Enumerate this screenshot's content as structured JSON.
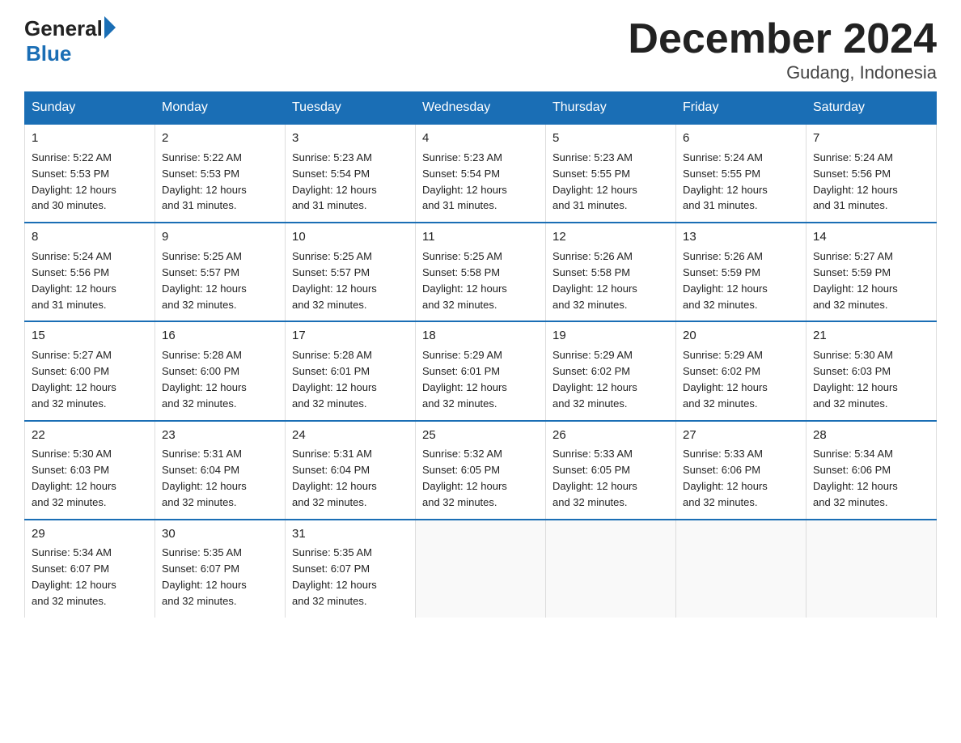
{
  "header": {
    "logo_general": "General",
    "logo_blue": "Blue",
    "month_title": "December 2024",
    "location": "Gudang, Indonesia"
  },
  "days_of_week": [
    "Sunday",
    "Monday",
    "Tuesday",
    "Wednesday",
    "Thursday",
    "Friday",
    "Saturday"
  ],
  "weeks": [
    [
      {
        "day": "1",
        "sunrise": "5:22 AM",
        "sunset": "5:53 PM",
        "daylight": "12 hours and 30 minutes."
      },
      {
        "day": "2",
        "sunrise": "5:22 AM",
        "sunset": "5:53 PM",
        "daylight": "12 hours and 31 minutes."
      },
      {
        "day": "3",
        "sunrise": "5:23 AM",
        "sunset": "5:54 PM",
        "daylight": "12 hours and 31 minutes."
      },
      {
        "day": "4",
        "sunrise": "5:23 AM",
        "sunset": "5:54 PM",
        "daylight": "12 hours and 31 minutes."
      },
      {
        "day": "5",
        "sunrise": "5:23 AM",
        "sunset": "5:55 PM",
        "daylight": "12 hours and 31 minutes."
      },
      {
        "day": "6",
        "sunrise": "5:24 AM",
        "sunset": "5:55 PM",
        "daylight": "12 hours and 31 minutes."
      },
      {
        "day": "7",
        "sunrise": "5:24 AM",
        "sunset": "5:56 PM",
        "daylight": "12 hours and 31 minutes."
      }
    ],
    [
      {
        "day": "8",
        "sunrise": "5:24 AM",
        "sunset": "5:56 PM",
        "daylight": "12 hours and 31 minutes."
      },
      {
        "day": "9",
        "sunrise": "5:25 AM",
        "sunset": "5:57 PM",
        "daylight": "12 hours and 32 minutes."
      },
      {
        "day": "10",
        "sunrise": "5:25 AM",
        "sunset": "5:57 PM",
        "daylight": "12 hours and 32 minutes."
      },
      {
        "day": "11",
        "sunrise": "5:25 AM",
        "sunset": "5:58 PM",
        "daylight": "12 hours and 32 minutes."
      },
      {
        "day": "12",
        "sunrise": "5:26 AM",
        "sunset": "5:58 PM",
        "daylight": "12 hours and 32 minutes."
      },
      {
        "day": "13",
        "sunrise": "5:26 AM",
        "sunset": "5:59 PM",
        "daylight": "12 hours and 32 minutes."
      },
      {
        "day": "14",
        "sunrise": "5:27 AM",
        "sunset": "5:59 PM",
        "daylight": "12 hours and 32 minutes."
      }
    ],
    [
      {
        "day": "15",
        "sunrise": "5:27 AM",
        "sunset": "6:00 PM",
        "daylight": "12 hours and 32 minutes."
      },
      {
        "day": "16",
        "sunrise": "5:28 AM",
        "sunset": "6:00 PM",
        "daylight": "12 hours and 32 minutes."
      },
      {
        "day": "17",
        "sunrise": "5:28 AM",
        "sunset": "6:01 PM",
        "daylight": "12 hours and 32 minutes."
      },
      {
        "day": "18",
        "sunrise": "5:29 AM",
        "sunset": "6:01 PM",
        "daylight": "12 hours and 32 minutes."
      },
      {
        "day": "19",
        "sunrise": "5:29 AM",
        "sunset": "6:02 PM",
        "daylight": "12 hours and 32 minutes."
      },
      {
        "day": "20",
        "sunrise": "5:29 AM",
        "sunset": "6:02 PM",
        "daylight": "12 hours and 32 minutes."
      },
      {
        "day": "21",
        "sunrise": "5:30 AM",
        "sunset": "6:03 PM",
        "daylight": "12 hours and 32 minutes."
      }
    ],
    [
      {
        "day": "22",
        "sunrise": "5:30 AM",
        "sunset": "6:03 PM",
        "daylight": "12 hours and 32 minutes."
      },
      {
        "day": "23",
        "sunrise": "5:31 AM",
        "sunset": "6:04 PM",
        "daylight": "12 hours and 32 minutes."
      },
      {
        "day": "24",
        "sunrise": "5:31 AM",
        "sunset": "6:04 PM",
        "daylight": "12 hours and 32 minutes."
      },
      {
        "day": "25",
        "sunrise": "5:32 AM",
        "sunset": "6:05 PM",
        "daylight": "12 hours and 32 minutes."
      },
      {
        "day": "26",
        "sunrise": "5:33 AM",
        "sunset": "6:05 PM",
        "daylight": "12 hours and 32 minutes."
      },
      {
        "day": "27",
        "sunrise": "5:33 AM",
        "sunset": "6:06 PM",
        "daylight": "12 hours and 32 minutes."
      },
      {
        "day": "28",
        "sunrise": "5:34 AM",
        "sunset": "6:06 PM",
        "daylight": "12 hours and 32 minutes."
      }
    ],
    [
      {
        "day": "29",
        "sunrise": "5:34 AM",
        "sunset": "6:07 PM",
        "daylight": "12 hours and 32 minutes."
      },
      {
        "day": "30",
        "sunrise": "5:35 AM",
        "sunset": "6:07 PM",
        "daylight": "12 hours and 32 minutes."
      },
      {
        "day": "31",
        "sunrise": "5:35 AM",
        "sunset": "6:07 PM",
        "daylight": "12 hours and 32 minutes."
      },
      null,
      null,
      null,
      null
    ]
  ]
}
